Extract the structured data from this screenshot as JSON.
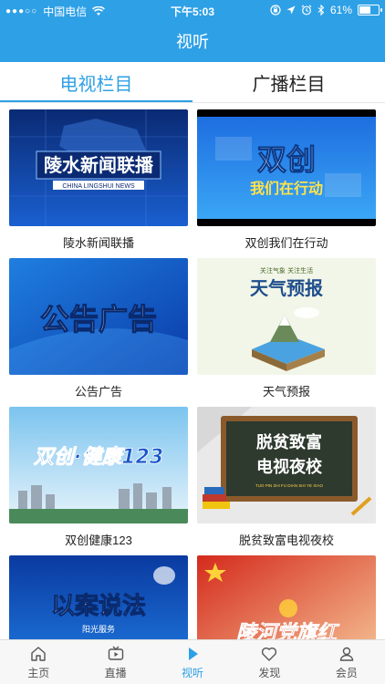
{
  "status_bar": {
    "signal": "●●●○○",
    "carrier": "中国电信",
    "time": "下午5:03",
    "battery": "61%",
    "battery_level": 0.61
  },
  "nav": {
    "title": "视听"
  },
  "tabs": [
    {
      "label": "电视栏目",
      "active": true
    },
    {
      "label": "广播栏目",
      "active": false
    }
  ],
  "programs": [
    {
      "title": "陵水新闻联播",
      "thumb_text": "陵水新闻联播",
      "thumb_subtext": "CHINA LINGSHUI NEWS"
    },
    {
      "title": "双创我们在行动",
      "thumb_text": "双创",
      "thumb_subtext": "我们在行动"
    },
    {
      "title": "公告广告",
      "thumb_text": "公告广告"
    },
    {
      "title": "天气预报",
      "thumb_text": "天气预报",
      "thumb_subtext": "关注气象 关注生活"
    },
    {
      "title": "双创健康123",
      "thumb_text": "双创·健康123"
    },
    {
      "title": "脱贫致富电视夜校",
      "thumb_text": "脱贫致富",
      "thumb_text2": "电视夜校",
      "thumb_subtext": "TUO PIN ZHI FU    DIAN SHI YE XIAO"
    },
    {
      "title": "",
      "thumb_text": "以案说法",
      "thumb_subtext": "阳光服务"
    },
    {
      "title": "",
      "thumb_text": "陵河党旗红"
    }
  ],
  "bottom_tabs": [
    {
      "label": "主页",
      "icon": "home-icon"
    },
    {
      "label": "直播",
      "icon": "tv-icon"
    },
    {
      "label": "视听",
      "icon": "play-icon",
      "active": true
    },
    {
      "label": "发现",
      "icon": "heart-icon"
    },
    {
      "label": "会员",
      "icon": "user-icon"
    }
  ],
  "colors": {
    "primary": "#2ea0e6"
  }
}
